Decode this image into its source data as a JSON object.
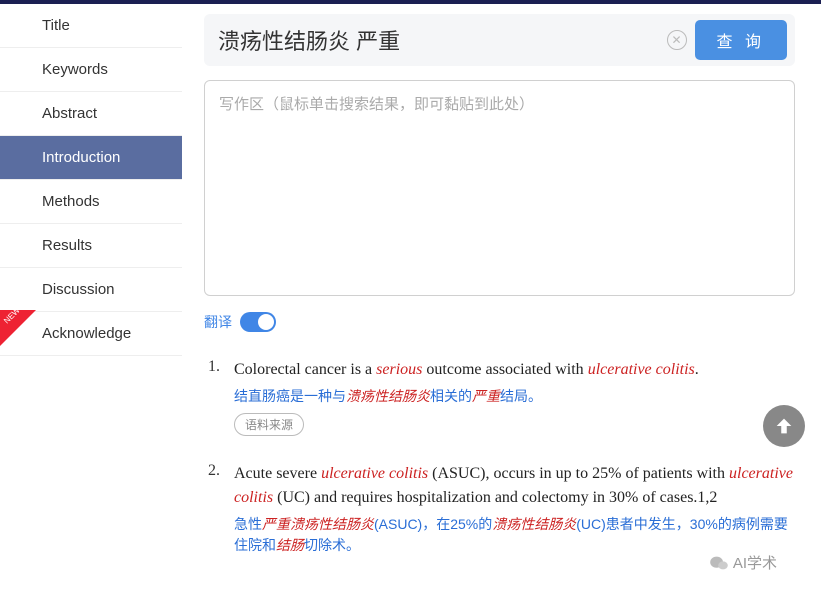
{
  "search": {
    "value": "溃疡性结肠炎 严重",
    "query_label": "查 询"
  },
  "writing_placeholder": "写作区（鼠标单击搜索结果，即可黏贴到此处）",
  "sidebar": {
    "items": [
      {
        "label": "Title"
      },
      {
        "label": "Keywords"
      },
      {
        "label": "Abstract"
      },
      {
        "label": "Introduction"
      },
      {
        "label": "Methods"
      },
      {
        "label": "Results"
      },
      {
        "label": "Discussion"
      },
      {
        "label": "Acknowledge"
      }
    ],
    "new_badge_text": "NEW"
  },
  "translate_label": "翻译",
  "source_label": "语料来源",
  "results": [
    {
      "num": "1.",
      "en_pre": "Colorectal cancer is a ",
      "en_hl1": "serious",
      "en_mid": " outcome associated with ",
      "en_hl2": "ulcerative colitis",
      "en_post": ".",
      "cn_pre": "结直肠癌是一种与",
      "cn_hl1": "溃疡性结肠炎",
      "cn_mid": "相关的",
      "cn_hl2": "严重",
      "cn_post": "结局。"
    },
    {
      "num": "2.",
      "en_pre": "Acute severe ",
      "en_hl1": "ulcerative colitis",
      "en_mid1": " (ASUC), occurs in up to 25% of patients with ",
      "en_hl2": "ulcerative colitis",
      "en_mid2": " (UC) and requires hospitalization and colectomy in 30% of cases.1,2",
      "cn_pre": "急性",
      "cn_hl1": "严重溃疡性结肠炎",
      "cn_mid1": "(ASUC)，在25%的",
      "cn_hl2": "溃疡性结肠炎",
      "cn_mid2": "(UC)患者中发生，30%的病例需要住院和",
      "cn_hl3": "结肠",
      "cn_post": "切除术。"
    }
  ],
  "watermark_text": "AI学术"
}
